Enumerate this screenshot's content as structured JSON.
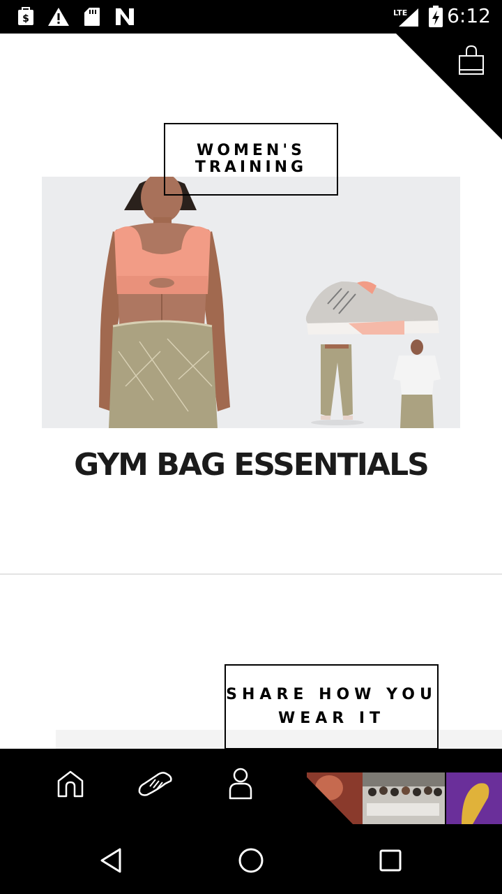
{
  "status_bar": {
    "time": "6:12",
    "network": "LTE",
    "icons": [
      "shopping-notification-icon",
      "warning-icon",
      "sd-card-icon",
      "n-app-icon",
      "signal-icon",
      "battery-charging-icon"
    ]
  },
  "header": {
    "bag_icon": "shopping-bag-icon"
  },
  "promo": {
    "category_label": "WOMEN'S TRAINING",
    "headline": "GYM BAG ESSENTIALS"
  },
  "community": {
    "label": "SHARE HOW YOU WEAR IT"
  },
  "bottom_nav": {
    "items": [
      {
        "icon": "home-icon"
      },
      {
        "icon": "shoe-icon"
      },
      {
        "icon": "profile-icon"
      }
    ]
  },
  "system_nav": {
    "items": [
      "back-icon",
      "home-circle-icon",
      "recents-icon"
    ]
  },
  "colors": {
    "accent": "#000000",
    "hero_background": "#ebecee",
    "headline": "#1b1b1b",
    "divider": "#e3e3e3"
  }
}
